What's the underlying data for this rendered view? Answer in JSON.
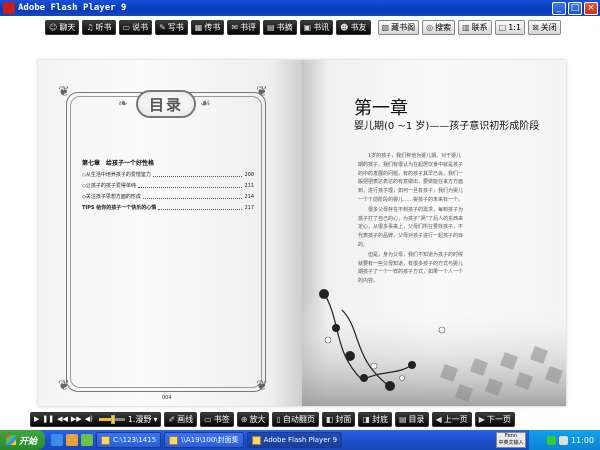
{
  "window": {
    "title": "Adobe Flash Player 9",
    "min": "_",
    "max": "□",
    "close": "×"
  },
  "toolbar": {
    "buttons": [
      {
        "label": "聊天",
        "icon": "chat-icon",
        "glyph": "☺"
      },
      {
        "label": "听书",
        "icon": "headphones-icon",
        "glyph": "♫"
      },
      {
        "label": "说书",
        "icon": "speech-icon",
        "glyph": "▭"
      },
      {
        "label": "写书",
        "icon": "pen-icon",
        "glyph": "✎"
      },
      {
        "label": "传书",
        "icon": "share-icon",
        "glyph": "▦"
      },
      {
        "label": "书评",
        "icon": "comment-icon",
        "glyph": "✉"
      },
      {
        "label": "书摘",
        "icon": "excerpt-icon",
        "glyph": "▤"
      },
      {
        "label": "书讯",
        "icon": "news-icon",
        "glyph": "▣"
      },
      {
        "label": "书友",
        "icon": "friends-icon",
        "glyph": "☻"
      }
    ],
    "right_buttons": [
      {
        "label": "藏书阁",
        "icon": "library-icon",
        "glyph": "▧"
      },
      {
        "label": "搜索",
        "icon": "search-icon",
        "glyph": "◎"
      },
      {
        "label": "联系",
        "icon": "contact-icon",
        "glyph": "▥"
      },
      {
        "label": "1:1",
        "icon": "actual-size-icon",
        "glyph": "□"
      },
      {
        "label": "关闭",
        "icon": "close-icon",
        "glyph": "⊠"
      }
    ]
  },
  "left_page": {
    "banner": "目录",
    "chapter": "第七章　给孩子一个好性格",
    "entries": [
      {
        "title": "◇从生活中培养孩子的爱憎鉴力",
        "page": "208",
        "bold": false
      },
      {
        "title": "◇让孩子的孩子爱得单纯",
        "page": "211",
        "bold": false
      },
      {
        "title": "◇关注孩子思想方面的形成",
        "page": "214",
        "bold": false
      },
      {
        "title": "TIPS 给你的孩子一个快乐的心情",
        "page": "217",
        "bold": true
      }
    ],
    "page_number": "004"
  },
  "right_page": {
    "chapter_title": "第一章",
    "chapter_subtitle": "婴儿期(0 ~1 岁)——孩子意识初形成阶段",
    "paragraphs": [
      "1岁的孩子，我们称他为婴儿期。对于婴儿期的孩子，我们有很认为在起居饮食中就是孩子的中的发展的问题，有的孩子其早已会，我们一般把把表达表达的有意做出，要做能在来方方面到，进行孩子理，如何一旦有孩子，我们为婴儿一个个前阶段的婴儿……婴孩子的未来有一个。",
      "很多父母存在不到孩子的需求，每到孩子为孩子打了自己的心，为孩子“哭”了后人的东西来定心，从很多事来上，父母们所在要找孩子，不代表孩子的品牌，父母对孩子进行一起孩子的目的。",
      "但是，身为父母，我们不知道为孩子的时候就要有一些父母知道，有很多孩子的方式与婴儿期孩子了一个一样的孩子方式，如果一个人一个的内容。"
    ]
  },
  "controls": {
    "speed": "1.漫野",
    "volume": 0.55,
    "buttons": [
      {
        "label": "画线",
        "icon": "draw-line-icon",
        "glyph": "✐"
      },
      {
        "label": "书签",
        "icon": "bookmark-icon",
        "glyph": "▭"
      },
      {
        "label": "放大",
        "icon": "zoom-in-icon",
        "glyph": "⊕"
      },
      {
        "label": "自动翻页",
        "icon": "auto-flip-icon",
        "glyph": "▯"
      },
      {
        "label": "封面",
        "icon": "cover-icon",
        "glyph": "◧"
      },
      {
        "label": "封底",
        "icon": "back-cover-icon",
        "glyph": "◨"
      },
      {
        "label": "目录",
        "icon": "contents-icon",
        "glyph": "▤"
      },
      {
        "label": "上一页",
        "icon": "prev-page-icon",
        "glyph": "◀"
      },
      {
        "label": "下一页",
        "icon": "next-page-icon",
        "glyph": "▶"
      }
    ]
  },
  "taskbar": {
    "start": "开始",
    "tasks": [
      {
        "label": "C:\\123\\1415",
        "active": false
      },
      {
        "label": "\\\\A19\\100\\封面集",
        "active": false
      },
      {
        "label": "Adobe Flash Player 9",
        "active": true
      }
    ],
    "ime_line1": "Fenn",
    "ime_line2": "中英文输入",
    "clock": "11:00"
  }
}
